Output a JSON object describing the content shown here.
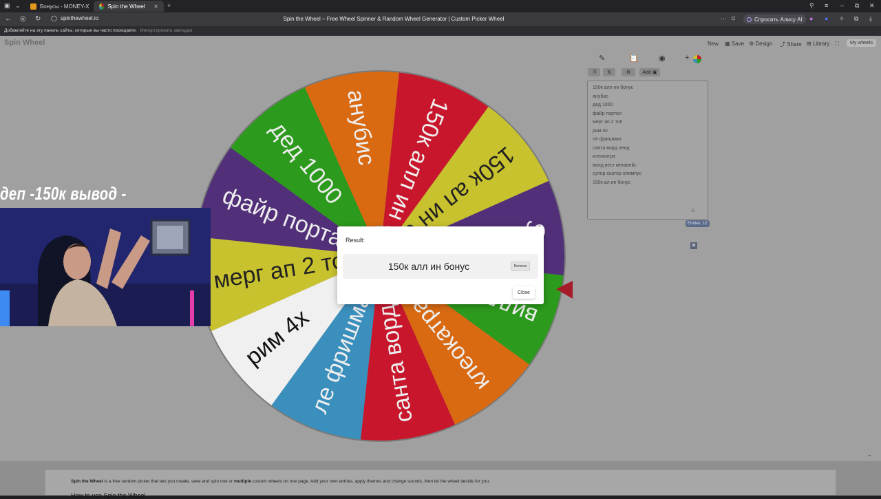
{
  "browser": {
    "tabs": [
      {
        "title": "Бонусы - MONEY-X"
      },
      {
        "title": "Spin the Wheel - Free W"
      }
    ],
    "url": "spinthewheel.io",
    "page_title": "Spin the Wheel – Free Wheel Spinner & Random Wheel Generator | Custom Picker Wheel",
    "alice_button": "Спросить Алису AI",
    "bookmarks_hint": "Добавляйте на эту панель сайты, которые вы часто посещаете.",
    "bookmarks_link": "Импортировать закладки"
  },
  "site": {
    "logo": "Spin Wheel",
    "menu": {
      "new": "New",
      "save": "Save",
      "design": "Design",
      "share": "Share",
      "library": "Library",
      "my_wheels": "My wheels"
    },
    "add_image_label": "Add",
    "entries": [
      "150к алл ин бонус",
      "анубис",
      "дед 1000",
      "файр портал",
      "мерг ап 2 топ",
      "рим 4х",
      "ле фришман",
      "санта ворд ленд",
      "клеокатра",
      "вилд вест мегавейс",
      "супер скатер олимпус",
      "150к ал ин бонус"
    ],
    "entries_count": "Entries: 12"
  },
  "wheel": {
    "segments": [
      {
        "label": "файр портал",
        "color": "#523079"
      },
      {
        "label": "дед 1000",
        "color": "#2c9a1c"
      },
      {
        "label": "анубис",
        "color": "#d96a12"
      },
      {
        "label": "150к алл ин бонус",
        "color": "#c8172c"
      },
      {
        "label": "150к ал ин бонус",
        "color": "#c9c22f"
      },
      {
        "label": "супер скатер олимпус",
        "color": "#523079"
      },
      {
        "label": "вилд вест мегавейс",
        "color": "#2c9a1c"
      },
      {
        "label": "клеокатра",
        "color": "#d96a12"
      },
      {
        "label": "санта ворд ленд",
        "color": "#c8172c"
      },
      {
        "label": "ле фришман",
        "color": "#3a8fbd"
      },
      {
        "label": "рим 4х",
        "color": "#f0f0f0"
      },
      {
        "label": "мерг ап 2 топ",
        "color": "#c9c22f"
      }
    ]
  },
  "stream_overlay": {
    "title": "деп -150к вывод -"
  },
  "dialog": {
    "label": "Result:",
    "result": "150к алл ин бонус",
    "remove": "Remove",
    "close": "Close"
  },
  "footer": {
    "brand": "Spin the Wheel",
    "text_a": "is a free random picker that lets you create, save and spin one or",
    "bold": "multiple",
    "text_b": "custom wheels on one page. Add your own entries, apply themes and change sounds, then let the wheel decide for you.",
    "heading": "How to use Spin the Wheel"
  }
}
